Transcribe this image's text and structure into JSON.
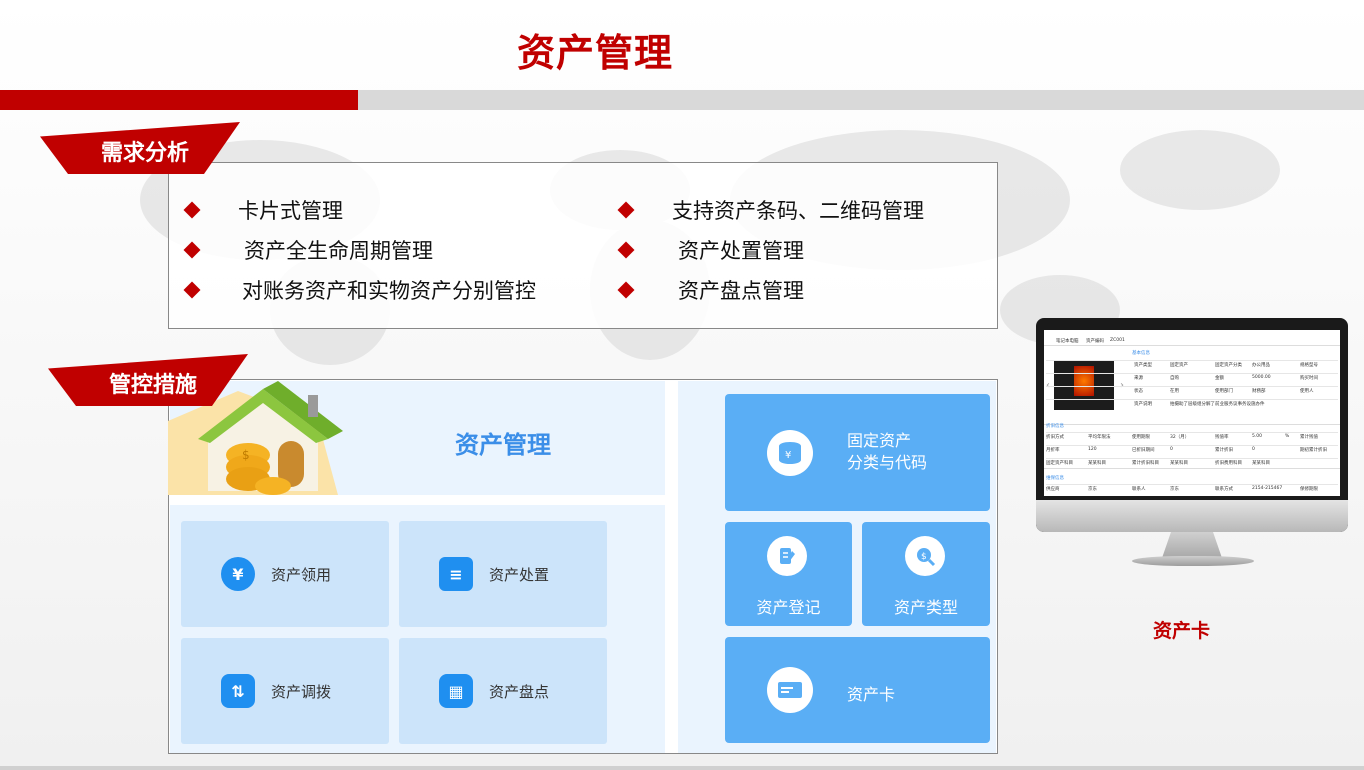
{
  "header": {
    "title": "资产管理"
  },
  "requirements": {
    "tag": "需求分析",
    "items_left": [
      "卡片式管理",
      "资产全生命周期管理",
      "对账务资产和实物资产分别管控"
    ],
    "items_right": [
      "支持资产条码、二维码管理",
      "资产处置管理",
      "资产盘点管理"
    ]
  },
  "controls": {
    "tag": "管控措施",
    "module_title": "资产管理",
    "left_tiles": [
      {
        "label": "资产领用",
        "icon": "hand-coin-icon"
      },
      {
        "label": "资产处置",
        "icon": "document-clock-icon"
      },
      {
        "label": "资产调拨",
        "icon": "transfer-icon"
      },
      {
        "label": "资产盘点",
        "icon": "abacus-icon"
      }
    ],
    "right_tiles": {
      "fixed_assets_line1": "固定资产",
      "fixed_assets_line2": "分类与代码",
      "register": "资产登记",
      "type": "资产类型",
      "card": "资产卡"
    }
  },
  "monitor": {
    "label": "资产卡",
    "screen": {
      "header_name": "笔记本电脑",
      "header_code_label": "资产编码",
      "header_code": "ZC001",
      "section_basic": "基本信息",
      "rows": [
        [
          "资产类型",
          "固定资产",
          "固定资产分类",
          "办公用品",
          "规格型号"
        ],
        [
          "来源",
          "自购",
          "金额",
          "5000.00",
          "购买时间"
        ],
        [
          "状态",
          "在用",
          "使用部门",
          "财務部",
          "使用人"
        ],
        [
          "资产说明",
          "拍摄助了层级组分解了前业服务议事务设施办件",
          "",
          "",
          ""
        ]
      ],
      "section_depr": "折旧信息",
      "rows2": [
        [
          "折旧方式",
          "平均年限法",
          "使用期限",
          "32（月）",
          "残值率",
          "5.00",
          "%",
          "累计残值"
        ],
        [
          "月折率",
          "120",
          "已折旧期间",
          "0",
          "累计折旧",
          "0",
          "",
          "期初累计折旧"
        ],
        [
          "固定资产科目",
          "某某科目",
          "累计折旧科目",
          "某某科目",
          "折旧费用科目",
          "某某科目",
          "",
          ""
        ]
      ],
      "section_vendor": "维保信息",
      "rows3": [
        [
          "供应商",
          "京东",
          "联系人",
          "京东",
          "联系方式",
          "2154-215467",
          "",
          "保修期限"
        ]
      ]
    }
  }
}
